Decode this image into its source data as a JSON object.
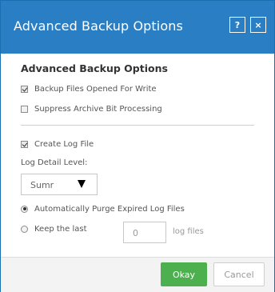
{
  "dialog": {
    "title": "Advanced Backup Options",
    "help_label": "?",
    "close_label": "×"
  },
  "content": {
    "section_title": "Advanced Backup Options",
    "backup_open_files": {
      "label": "Backup Files Opened For Write",
      "checked": true
    },
    "suppress_archive_bit": {
      "label": "Suppress Archive Bit Processing",
      "checked": false
    },
    "create_log_file": {
      "label": "Create Log File",
      "checked": true
    },
    "log_detail_label": "Log Detail Level:",
    "log_detail_value": "Sumr",
    "auto_purge": {
      "label": "Automatically Purge Expired Log Files",
      "selected": true
    },
    "keep_last": {
      "label": "Keep the last",
      "selected": false,
      "value": "0",
      "unit": "log files"
    }
  },
  "footer": {
    "ok_label": "Okay",
    "cancel_label": "Cancel"
  },
  "colors": {
    "titlebar": "#2a7fc4",
    "ok_button": "#4cb04f"
  }
}
